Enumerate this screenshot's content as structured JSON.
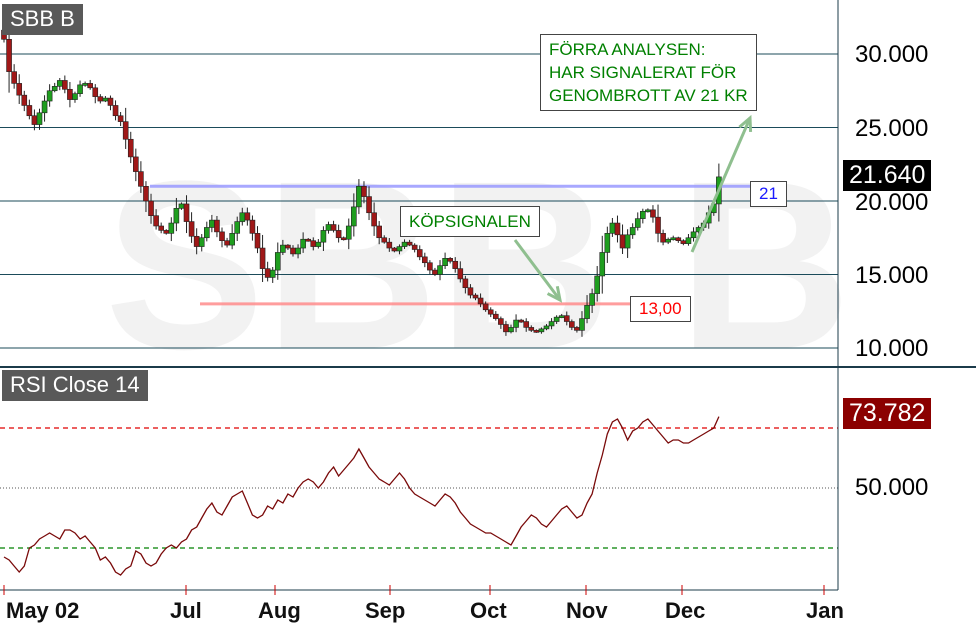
{
  "chart_data": [
    {
      "type": "candlestick",
      "title": "SBB B",
      "ylim": [
        9000,
        33000
      ],
      "yticks": [
        "10.000",
        "15.000",
        "20.000",
        "25.000",
        "30.000"
      ],
      "last_value_label": "21.640",
      "x_ticks": [
        "May 02",
        "Jul",
        "Aug",
        "Sep",
        "Oct",
        "Nov",
        "Dec",
        "Jan"
      ],
      "levels": [
        {
          "value": 21000,
          "label": "21",
          "color": "#1a1aff"
        },
        {
          "value": 13000,
          "label": "13,00",
          "color": "#ff0000"
        }
      ],
      "annotations": [
        {
          "id": "forra",
          "lines": [
            "FÖRRA ANALYSEN:",
            "HAR SIGNALERAT FÖR",
            "GENOMBROTT AV 21 KR"
          ]
        },
        {
          "id": "kop",
          "lines": [
            "KÖPSIGNALEN"
          ]
        }
      ],
      "watermark": "SBB B",
      "close": [
        31000,
        28800,
        28000,
        27200,
        26500,
        25800,
        25200,
        26000,
        26800,
        27500,
        27800,
        28200,
        27600,
        26900,
        27300,
        27900,
        28000,
        27700,
        27100,
        26800,
        27000,
        26500,
        25800,
        25400,
        24200,
        23000,
        22000,
        21000,
        20000,
        19000,
        18300,
        18000,
        17800,
        18500,
        19500,
        19800,
        18600,
        17600,
        16900,
        17500,
        18200,
        18700,
        17900,
        17300,
        17000,
        17800,
        18600,
        19200,
        18700,
        17800,
        16800,
        15400,
        14800,
        15300,
        16500,
        17000,
        16800,
        16400,
        16800,
        17400,
        17300,
        16900,
        17200,
        18000,
        18400,
        18000,
        17500,
        17400,
        18300,
        19600,
        21000,
        20300,
        19200,
        18300,
        17500,
        17200,
        16800,
        16600,
        16900,
        17200,
        17000,
        16700,
        16200,
        15800,
        15300,
        15000,
        15600,
        16100,
        15900,
        15400,
        14700,
        14100,
        13600,
        13400,
        13000,
        12600,
        12300,
        12000,
        11600,
        11100,
        11400,
        11900,
        11800,
        11400,
        11200,
        11100,
        11300,
        11500,
        11800,
        12100,
        12200,
        11800,
        11400,
        11200,
        12000,
        12900,
        13700,
        14900,
        16500,
        17800,
        18500,
        17700,
        16800,
        17700,
        18200,
        18800,
        19300,
        19400,
        18900,
        17800,
        17200,
        17400,
        17500,
        17300,
        17100,
        17500,
        17900,
        18200,
        18500,
        19200,
        19800,
        21640
      ],
      "rsi": {
        "title": "RSI Close 14",
        "last_value_label": "73.782",
        "ylim": [
          21,
          83
        ],
        "ytick": "50.000",
        "levels": [
          70,
          30
        ],
        "values": [
          27,
          26,
          24,
          22,
          24,
          30,
          31,
          33,
          34,
          35,
          34,
          33,
          36,
          36,
          35,
          33,
          34,
          32,
          30,
          26,
          27,
          25,
          22,
          21,
          23,
          24,
          29,
          28,
          25,
          24,
          25,
          28,
          30,
          31,
          30,
          32,
          33,
          36,
          37,
          40,
          43,
          45,
          42,
          41,
          44,
          47,
          48,
          49,
          45,
          41,
          40,
          41,
          44,
          43,
          46,
          45,
          48,
          47,
          50,
          52,
          53,
          52,
          50,
          52,
          55,
          57,
          54,
          56,
          58,
          60,
          63,
          60,
          57,
          55,
          53,
          52,
          51,
          53,
          55,
          53,
          50,
          48,
          47,
          46,
          45,
          44,
          46,
          48,
          47,
          45,
          42,
          40,
          38,
          37,
          36,
          35,
          35,
          34,
          33,
          32,
          31,
          34,
          37,
          39,
          41,
          40,
          38,
          37,
          39,
          41,
          43,
          44,
          42,
          40,
          41,
          45,
          48,
          55,
          61,
          68,
          72,
          73,
          70,
          66,
          69,
          70,
          72,
          73,
          71,
          69,
          67,
          65,
          66,
          66,
          65,
          65,
          66,
          67,
          68,
          69,
          70,
          73.8
        ]
      }
    }
  ]
}
